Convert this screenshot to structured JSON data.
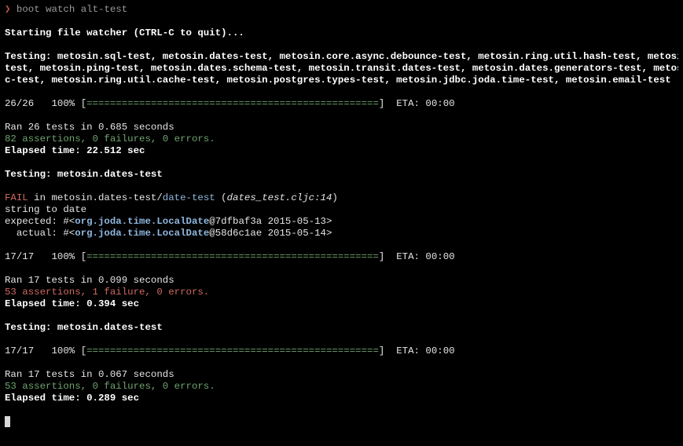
{
  "prompt": {
    "arrow": "❯",
    "command": "boot watch alt-test"
  },
  "watcher_banner": "Starting file watcher (CTRL-C to quit)...",
  "run1": {
    "testing_line1": "Testing: metosin.sql-test, metosin.dates-test, metosin.core.async.debounce-test, metosin.ring.util.hash-test, metosin.loc-",
    "testing_line2": "test, metosin.ping-test, metosin.dates.schema-test, metosin.transit.dates-test, metosin.dates.generators-test, metosin.jdb",
    "testing_line3": "c-test, metosin.ring.util.cache-test, metosin.postgres.types-test, metosin.jdbc.joda.time-test, metosin.email-test",
    "progress_count": "26/26",
    "progress_percent": "100%",
    "progress_bar": "==================================================",
    "eta": "ETA: 00:00",
    "ran": "Ran 26 tests in 0.685 seconds",
    "assertions": "82 assertions, 0 failures, 0 errors.",
    "elapsed": "Elapsed time: 22.512 sec"
  },
  "run2": {
    "testing": "Testing: metosin.dates-test",
    "fail_word": "FAIL",
    "fail_in": " in metosin.dates-test/",
    "fail_test": "date-test",
    "fail_location_open": " (",
    "fail_location": "dates_test.cljc:14",
    "fail_location_close": ")",
    "message": "string to date",
    "expected_label": "expected: #<",
    "expected_class": "org.joda.time.LocalDate",
    "expected_rest": "@7dfbaf3a 2015-05-13>",
    "actual_label": "  actual: #<",
    "actual_class": "org.joda.time.LocalDate",
    "actual_rest": "@58d6c1ae 2015-05-14>",
    "progress_count": "17/17",
    "progress_percent": "100%",
    "progress_bar": "==================================================",
    "eta": "ETA: 00:00",
    "ran": "Ran 17 tests in 0.099 seconds",
    "assertions": "53 assertions, 1 failure, 0 errors.",
    "elapsed": "Elapsed time: 0.394 sec"
  },
  "run3": {
    "testing": "Testing: metosin.dates-test",
    "progress_count": "17/17",
    "progress_percent": "100%",
    "progress_bar": "==================================================",
    "eta": "ETA: 00:00",
    "ran": "Ran 17 tests in 0.067 seconds",
    "assertions": "53 assertions, 0 failures, 0 errors.",
    "elapsed": "Elapsed time: 0.289 sec"
  },
  "colors": {
    "background": "#000000",
    "pass": "#6fa46f",
    "fail": "#d06a60",
    "class": "#8fb7de"
  }
}
